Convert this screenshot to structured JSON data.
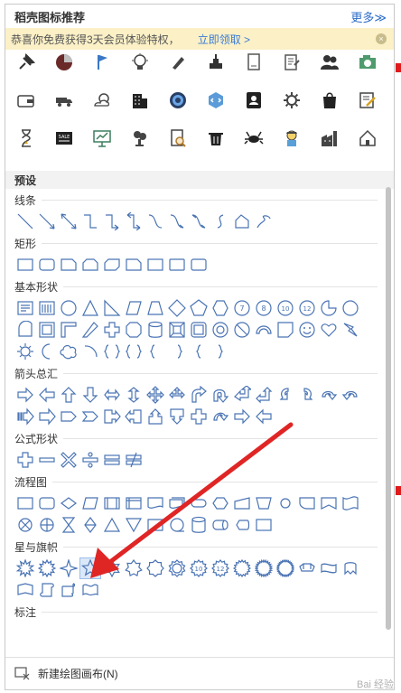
{
  "panel": {
    "title": "稻壳图标推荐",
    "more_label": "更多≫",
    "promo_text": "恭喜你免费获得3天会员体验特权，",
    "promo_link": "立即领取 >",
    "preset_label": "预设"
  },
  "icons": [
    "pin-icon",
    "pie-chart-icon",
    "flag-icon",
    "lightbulb-icon",
    "pen-icon",
    "inkwell-icon",
    "document-icon",
    "notes-icon",
    "users-icon",
    "camera-icon",
    "wallet-icon",
    "truck-icon",
    "weather-icon",
    "building-icon",
    "target-icon",
    "hexagon-code-icon",
    "contact-card-icon",
    "gear-icon",
    "bag-icon",
    "edit-icon",
    "hourglass-icon",
    "sale-sign-icon",
    "presentation-icon",
    "bonsai-icon",
    "search-doc-icon",
    "trash-icon",
    "crab-icon",
    "worker-icon",
    "factory-icon",
    "house-icon"
  ],
  "sections": [
    {
      "title": "线条",
      "count": 12
    },
    {
      "title": "矩形",
      "count": 9
    },
    {
      "title": "基本形状",
      "count": 42
    },
    {
      "title": "箭头总汇",
      "count": 28
    },
    {
      "title": "公式形状",
      "count": 6
    },
    {
      "title": "流程图",
      "count": 28
    },
    {
      "title": "星与旗帜",
      "count": 20
    },
    {
      "title": "标注",
      "count": 0
    }
  ],
  "bottom": {
    "label": "新建绘图画布(N)"
  },
  "watermark": "Bai 经验",
  "colors": {
    "accent": "#2b6cc9",
    "shape_stroke": "#4a74b4",
    "arrow": "#e02525"
  }
}
